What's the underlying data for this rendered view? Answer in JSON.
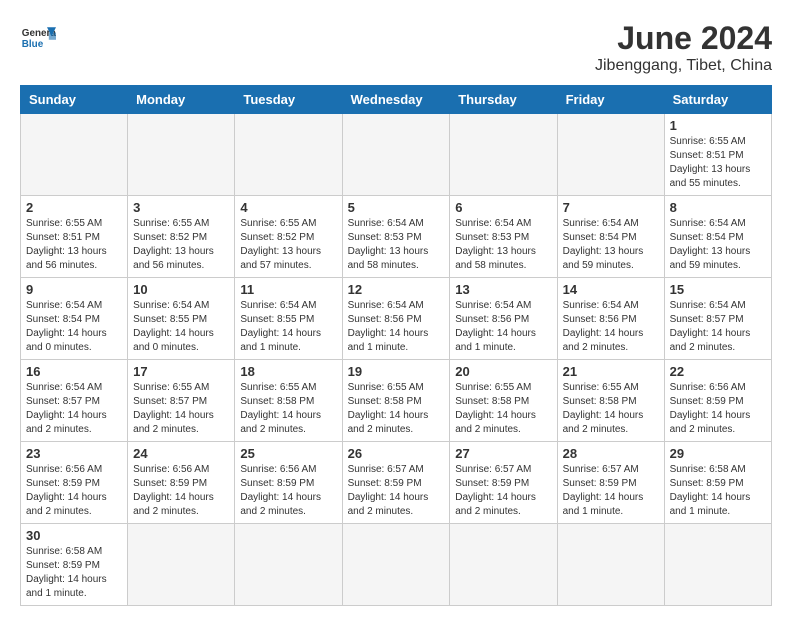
{
  "header": {
    "logo_general": "General",
    "logo_blue": "Blue",
    "title": "June 2024",
    "subtitle": "Jibenggang, Tibet, China"
  },
  "weekdays": [
    "Sunday",
    "Monday",
    "Tuesday",
    "Wednesday",
    "Thursday",
    "Friday",
    "Saturday"
  ],
  "days": [
    {
      "num": "",
      "info": ""
    },
    {
      "num": "",
      "info": ""
    },
    {
      "num": "",
      "info": ""
    },
    {
      "num": "",
      "info": ""
    },
    {
      "num": "",
      "info": ""
    },
    {
      "num": "",
      "info": ""
    },
    {
      "num": "1",
      "info": "Sunrise: 6:55 AM\nSunset: 8:51 PM\nDaylight: 13 hours and 55 minutes."
    },
    {
      "num": "2",
      "info": "Sunrise: 6:55 AM\nSunset: 8:51 PM\nDaylight: 13 hours and 56 minutes."
    },
    {
      "num": "3",
      "info": "Sunrise: 6:55 AM\nSunset: 8:52 PM\nDaylight: 13 hours and 56 minutes."
    },
    {
      "num": "4",
      "info": "Sunrise: 6:55 AM\nSunset: 8:52 PM\nDaylight: 13 hours and 57 minutes."
    },
    {
      "num": "5",
      "info": "Sunrise: 6:54 AM\nSunset: 8:53 PM\nDaylight: 13 hours and 58 minutes."
    },
    {
      "num": "6",
      "info": "Sunrise: 6:54 AM\nSunset: 8:53 PM\nDaylight: 13 hours and 58 minutes."
    },
    {
      "num": "7",
      "info": "Sunrise: 6:54 AM\nSunset: 8:54 PM\nDaylight: 13 hours and 59 minutes."
    },
    {
      "num": "8",
      "info": "Sunrise: 6:54 AM\nSunset: 8:54 PM\nDaylight: 13 hours and 59 minutes."
    },
    {
      "num": "9",
      "info": "Sunrise: 6:54 AM\nSunset: 8:54 PM\nDaylight: 14 hours and 0 minutes."
    },
    {
      "num": "10",
      "info": "Sunrise: 6:54 AM\nSunset: 8:55 PM\nDaylight: 14 hours and 0 minutes."
    },
    {
      "num": "11",
      "info": "Sunrise: 6:54 AM\nSunset: 8:55 PM\nDaylight: 14 hours and 1 minute."
    },
    {
      "num": "12",
      "info": "Sunrise: 6:54 AM\nSunset: 8:56 PM\nDaylight: 14 hours and 1 minute."
    },
    {
      "num": "13",
      "info": "Sunrise: 6:54 AM\nSunset: 8:56 PM\nDaylight: 14 hours and 1 minute."
    },
    {
      "num": "14",
      "info": "Sunrise: 6:54 AM\nSunset: 8:56 PM\nDaylight: 14 hours and 2 minutes."
    },
    {
      "num": "15",
      "info": "Sunrise: 6:54 AM\nSunset: 8:57 PM\nDaylight: 14 hours and 2 minutes."
    },
    {
      "num": "16",
      "info": "Sunrise: 6:54 AM\nSunset: 8:57 PM\nDaylight: 14 hours and 2 minutes."
    },
    {
      "num": "17",
      "info": "Sunrise: 6:55 AM\nSunset: 8:57 PM\nDaylight: 14 hours and 2 minutes."
    },
    {
      "num": "18",
      "info": "Sunrise: 6:55 AM\nSunset: 8:58 PM\nDaylight: 14 hours and 2 minutes."
    },
    {
      "num": "19",
      "info": "Sunrise: 6:55 AM\nSunset: 8:58 PM\nDaylight: 14 hours and 2 minutes."
    },
    {
      "num": "20",
      "info": "Sunrise: 6:55 AM\nSunset: 8:58 PM\nDaylight: 14 hours and 2 minutes."
    },
    {
      "num": "21",
      "info": "Sunrise: 6:55 AM\nSunset: 8:58 PM\nDaylight: 14 hours and 2 minutes."
    },
    {
      "num": "22",
      "info": "Sunrise: 6:56 AM\nSunset: 8:59 PM\nDaylight: 14 hours and 2 minutes."
    },
    {
      "num": "23",
      "info": "Sunrise: 6:56 AM\nSunset: 8:59 PM\nDaylight: 14 hours and 2 minutes."
    },
    {
      "num": "24",
      "info": "Sunrise: 6:56 AM\nSunset: 8:59 PM\nDaylight: 14 hours and 2 minutes."
    },
    {
      "num": "25",
      "info": "Sunrise: 6:56 AM\nSunset: 8:59 PM\nDaylight: 14 hours and 2 minutes."
    },
    {
      "num": "26",
      "info": "Sunrise: 6:57 AM\nSunset: 8:59 PM\nDaylight: 14 hours and 2 minutes."
    },
    {
      "num": "27",
      "info": "Sunrise: 6:57 AM\nSunset: 8:59 PM\nDaylight: 14 hours and 2 minutes."
    },
    {
      "num": "28",
      "info": "Sunrise: 6:57 AM\nSunset: 8:59 PM\nDaylight: 14 hours and 1 minute."
    },
    {
      "num": "29",
      "info": "Sunrise: 6:58 AM\nSunset: 8:59 PM\nDaylight: 14 hours and 1 minute."
    },
    {
      "num": "30",
      "info": "Sunrise: 6:58 AM\nSunset: 8:59 PM\nDaylight: 14 hours and 1 minute."
    },
    {
      "num": "",
      "info": ""
    },
    {
      "num": "",
      "info": ""
    },
    {
      "num": "",
      "info": ""
    },
    {
      "num": "",
      "info": ""
    },
    {
      "num": "",
      "info": ""
    },
    {
      "num": "",
      "info": ""
    }
  ]
}
